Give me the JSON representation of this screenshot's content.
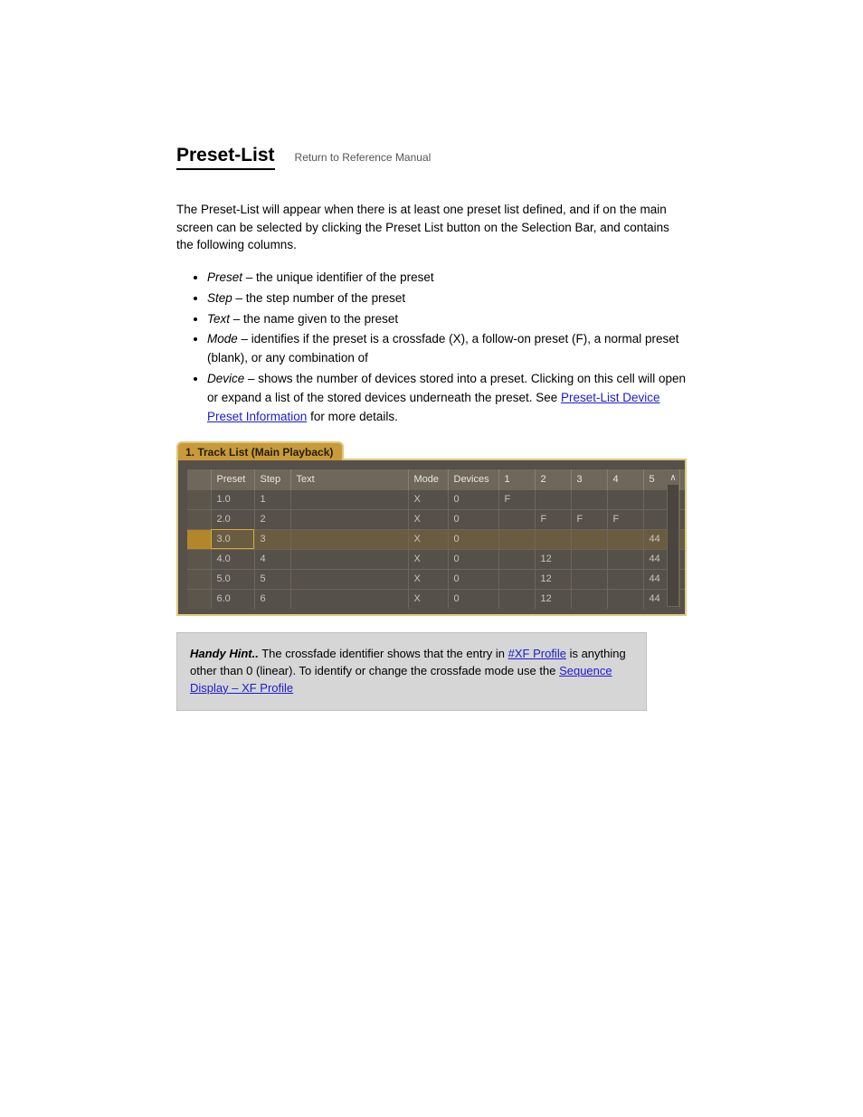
{
  "heading": "Preset-List",
  "return_label": "Return to Reference Manual",
  "intro": "The Preset-List will appear when there is at least one preset list defined, and if on the main screen can be selected by clicking the Preset List button on the Selection Bar, and contains the following columns.",
  "bullets": [
    {
      "label": "Preset",
      "rest": " – the unique identifier of the preset"
    },
    {
      "label": "Step",
      "rest": " – the step number of the preset"
    },
    {
      "label": "Text",
      "rest": " – the name given to the preset"
    },
    {
      "label": "Mode",
      "rest": " – identifies if the preset is a crossfade (X), a follow-on preset (F), a normal preset (blank), or any combination of"
    },
    {
      "label": "Device",
      "rest_html": " – shows the number of devices stored into a preset. Clicking on this cell will open or expand a list of the stored devices underneath the preset. See ",
      "link_text": "Preset-List Device Preset Information",
      "rest_after": " for more details."
    }
  ],
  "panel_tab": "1. Track List (Main Playback)",
  "table": {
    "headers": [
      "",
      "Preset",
      "Step",
      "Text",
      "Mode",
      "Devices",
      "1",
      "2",
      "3",
      "4",
      "5",
      ""
    ],
    "rows": [
      {
        "preset": "1.0",
        "step": "1",
        "text": "",
        "mode": "X",
        "devices": "0",
        "c1": "F",
        "c2": "",
        "c3": "",
        "c4": "",
        "c5": "",
        "selected": false
      },
      {
        "preset": "2.0",
        "step": "2",
        "text": "",
        "mode": "X",
        "devices": "0",
        "c1": "",
        "c2": "F",
        "c3": "F",
        "c4": "F",
        "c5": "",
        "selected": false
      },
      {
        "preset": "3.0",
        "step": "3",
        "text": "",
        "mode": "X",
        "devices": "0",
        "c1": "",
        "c2": "",
        "c3": "",
        "c4": "",
        "c5": "44",
        "selected": true
      },
      {
        "preset": "4.0",
        "step": "4",
        "text": "",
        "mode": "X",
        "devices": "0",
        "c1": "",
        "c2": "12",
        "c3": "",
        "c4": "",
        "c5": "44",
        "selected": false
      },
      {
        "preset": "5.0",
        "step": "5",
        "text": "",
        "mode": "X",
        "devices": "0",
        "c1": "",
        "c2": "12",
        "c3": "",
        "c4": "",
        "c5": "44",
        "selected": false
      },
      {
        "preset": "6.0",
        "step": "6",
        "text": "",
        "mode": "X",
        "devices": "0",
        "c1": "",
        "c2": "12",
        "c3": "",
        "c4": "",
        "c5": "44",
        "selected": false
      }
    ]
  },
  "infobox": {
    "lead": "Handy Hint..",
    "body_before": " The crossfade identifier shows that the entry in ",
    "link1": "#XF Profile",
    "body_mid": " is anything other than 0 (linear). To identify or change the crossfade mode use the ",
    "link2": "Sequence Display – XF Profile",
    "body_after": ""
  }
}
